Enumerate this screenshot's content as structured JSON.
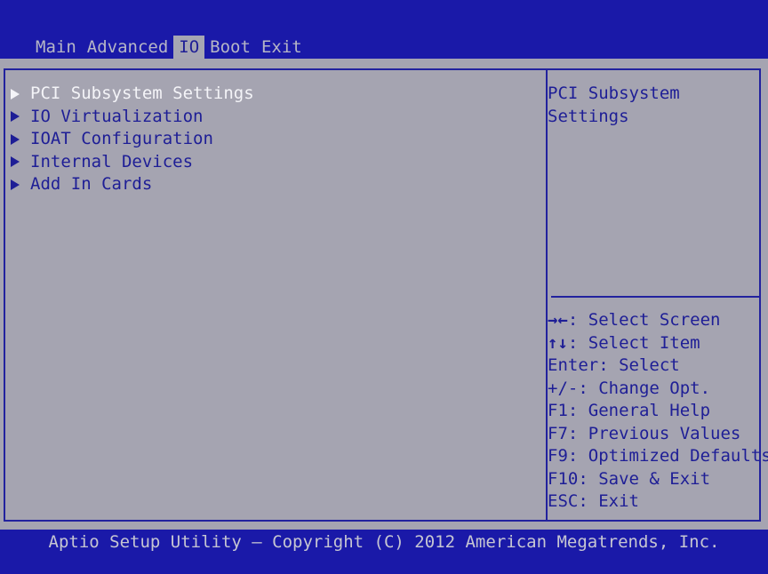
{
  "tabs": [
    {
      "label": "Main"
    },
    {
      "label": "Advanced"
    },
    {
      "label": "IO"
    },
    {
      "label": "Boot"
    },
    {
      "label": "Exit"
    }
  ],
  "menu_items": [
    {
      "label": "PCI Subsystem Settings"
    },
    {
      "label": "IO Virtualization"
    },
    {
      "label": "IOAT Configuration"
    },
    {
      "label": "Internal Devices"
    },
    {
      "label": "Add In Cards"
    }
  ],
  "help": {
    "description": "PCI Subsystem Settings"
  },
  "keys": [
    {
      "sym": "→←",
      "text": ": Select Screen"
    },
    {
      "sym": "↑↓",
      "text": ": Select Item"
    },
    {
      "sym": "",
      "text": "Enter: Select"
    },
    {
      "sym": "",
      "text": "+/-: Change Opt."
    },
    {
      "sym": "",
      "text": "F1: General Help"
    },
    {
      "sym": "",
      "text": "F7: Previous Values"
    },
    {
      "sym": "",
      "text": "F9: Optimized Defaults"
    },
    {
      "sym": "",
      "text": "F10: Save & Exit"
    },
    {
      "sym": "",
      "text": "ESC: Exit"
    }
  ],
  "footer": {
    "copyright": "Aptio Setup Utility – Copyright (C) 2012 American Megatrends, Inc."
  },
  "colors": {
    "bar_blue": "#1a19a8",
    "panel_gray": "#a5a4b1",
    "text_blue": "#1e1e96",
    "highlight_white": "#f4f4f8"
  }
}
